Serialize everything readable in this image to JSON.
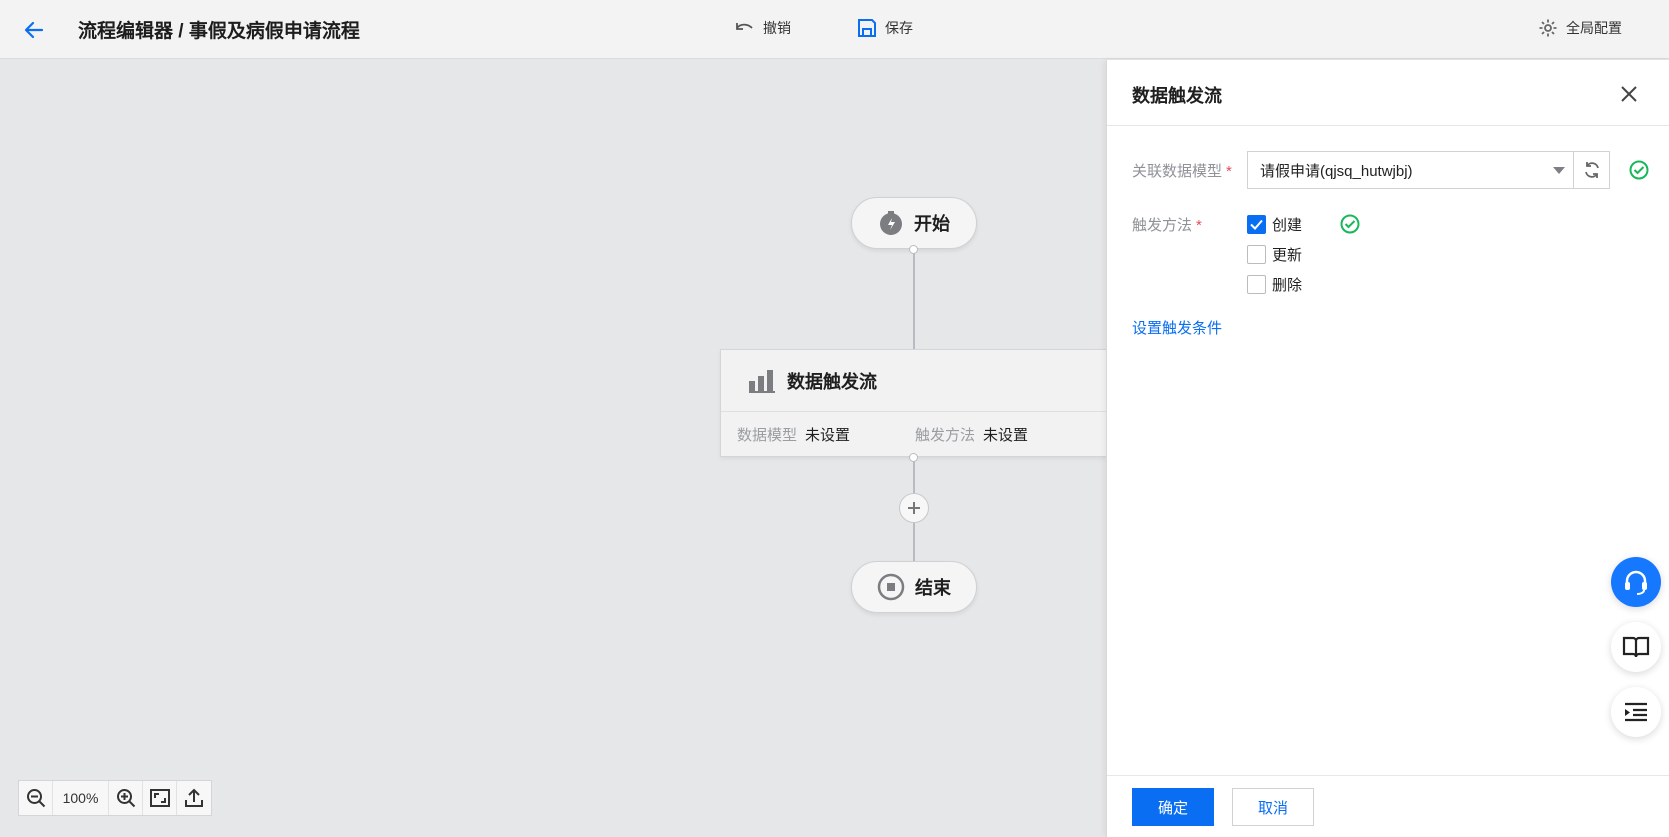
{
  "header": {
    "title": "流程编辑器 / 事假及病假申请流程",
    "undo_label": "撤销",
    "save_label": "保存",
    "global_config_label": "全局配置"
  },
  "canvas": {
    "start_label": "开始",
    "end_label": "结束",
    "node": {
      "title": "数据触发流",
      "model_label": "数据模型",
      "model_value": "未设置",
      "method_label": "触发方法",
      "method_value": "未设置"
    },
    "zoom": "100%"
  },
  "drawer": {
    "title": "数据触发流",
    "model_field_label": "关联数据模型",
    "model_selected": "请假申请(qjsq_hutwjbj)",
    "method_field_label": "触发方法",
    "required_mark": "*",
    "methods": [
      {
        "label": "创建",
        "checked": true
      },
      {
        "label": "更新",
        "checked": false
      },
      {
        "label": "删除",
        "checked": false
      }
    ],
    "condition_link": "设置触发条件",
    "confirm_label": "确定",
    "cancel_label": "取消"
  },
  "colors": {
    "accent": "#0a6ef2",
    "success": "#16b85a",
    "required": "#e34d59"
  },
  "icons": [
    "back-arrow-icon",
    "undo-icon",
    "save-icon",
    "gear-icon",
    "stopwatch-icon",
    "bar-chart-icon",
    "stop-icon",
    "plus-icon",
    "zoom-out-icon",
    "zoom-in-icon",
    "fit-screen-icon",
    "export-icon",
    "close-icon",
    "refresh-icon",
    "success-check-icon",
    "headset-icon",
    "book-icon",
    "outline-icon"
  ]
}
